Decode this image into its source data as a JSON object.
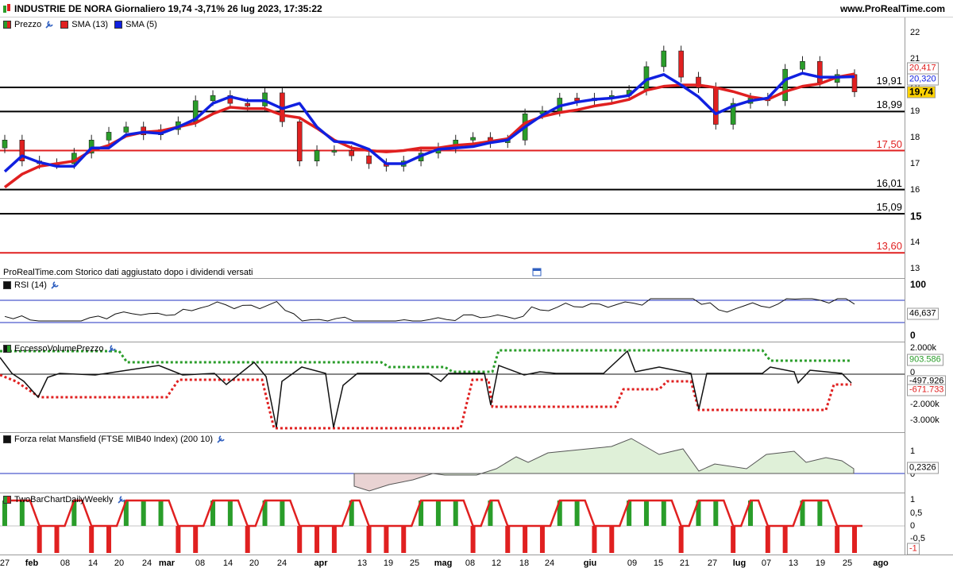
{
  "header": {
    "title": "INDUSTRIE DE NORA Giornaliero 19,74 -3,71% 26 lug 2023, 17:35:22",
    "brand": "www.ProRealTime.com"
  },
  "price_panel": {
    "legend": [
      {
        "label": "Prezzo",
        "color": "#2a9d2a"
      },
      {
        "label": "SMA (13)",
        "color": "#e02020"
      },
      {
        "label": "SMA (5)",
        "color": "#1020e0"
      }
    ],
    "note": "ProRealTime.com  Storico dati aggiustato dopo i dividendi versati",
    "y_ticks": [
      "22",
      "21",
      "20",
      "19",
      "18",
      "17",
      "16",
      "15",
      "14",
      "13"
    ],
    "levels": [
      {
        "label": "19,91",
        "value": 19.91,
        "color": "#000000"
      },
      {
        "label": "18,99",
        "value": 18.99,
        "color": "#000000"
      },
      {
        "label": "17,50",
        "value": 17.5,
        "color": "#e02020"
      },
      {
        "label": "16,01",
        "value": 16.01,
        "color": "#000000"
      },
      {
        "label": "15,09",
        "value": 15.09,
        "color": "#000000"
      },
      {
        "label": "13,60",
        "value": 13.6,
        "color": "#e02020"
      }
    ],
    "badges": {
      "sma13": "20,417",
      "sma5": "20,320",
      "price": "19,74"
    }
  },
  "rsi_panel": {
    "legend": "RSI (14)",
    "top": "100",
    "bottom": "0",
    "value": "46,637"
  },
  "evp_panel": {
    "legend": "EccessoVolumePrezzo",
    "ticks": [
      "2.000k",
      "0",
      "-2.000k",
      "-3.000k"
    ],
    "green_value": "903.586",
    "black_value": "-497.926",
    "red_value": "-671.733"
  },
  "mansfield_panel": {
    "legend": "Forza relat Mansfield (FTSE MIB40 Index) (200 10)",
    "tick_top": "1",
    "tick_zero": "0",
    "value": "0,2326"
  },
  "twobar_panel": {
    "legend": "TwoBarChartDailyWeekly",
    "ticks": [
      "1",
      "0,5",
      "0",
      "-0,5"
    ],
    "value": "-1"
  },
  "x_axis": [
    {
      "label": "27",
      "bold": false
    },
    {
      "label": "feb",
      "bold": true
    },
    {
      "label": "08",
      "bold": false
    },
    {
      "label": "14",
      "bold": false
    },
    {
      "label": "20",
      "bold": false
    },
    {
      "label": "24",
      "bold": false
    },
    {
      "label": "mar",
      "bold": true
    },
    {
      "label": "08",
      "bold": false
    },
    {
      "label": "14",
      "bold": false
    },
    {
      "label": "20",
      "bold": false
    },
    {
      "label": "24",
      "bold": false
    },
    {
      "label": "apr",
      "bold": true
    },
    {
      "label": "13",
      "bold": false
    },
    {
      "label": "19",
      "bold": false
    },
    {
      "label": "25",
      "bold": false
    },
    {
      "label": "mag",
      "bold": true
    },
    {
      "label": "08",
      "bold": false
    },
    {
      "label": "12",
      "bold": false
    },
    {
      "label": "18",
      "bold": false
    },
    {
      "label": "24",
      "bold": false
    },
    {
      "label": "giu",
      "bold": true
    },
    {
      "label": "09",
      "bold": false
    },
    {
      "label": "15",
      "bold": false
    },
    {
      "label": "21",
      "bold": false
    },
    {
      "label": "27",
      "bold": false
    },
    {
      "label": "lug",
      "bold": true
    },
    {
      "label": "07",
      "bold": false
    },
    {
      "label": "13",
      "bold": false
    },
    {
      "label": "19",
      "bold": false
    },
    {
      "label": "25",
      "bold": false
    },
    {
      "label": "ago",
      "bold": true
    }
  ],
  "chart_data": {
    "type": "candlestick",
    "series": [
      {
        "name": "SMA (5)",
        "values": [
          16.7,
          17.3,
          17.05,
          16.9,
          16.9,
          17.6,
          17.6,
          18.1,
          18.2,
          18.15,
          18.4,
          18.7,
          19.3,
          19.55,
          19.4,
          19.4,
          19.1,
          19.3,
          18.4,
          17.85,
          17.8,
          17.55,
          17.0,
          17.0,
          17.3,
          17.55,
          17.6,
          17.65,
          17.8,
          17.9,
          18.4,
          18.85,
          19.2,
          19.35,
          19.45,
          19.5,
          19.6,
          20.2,
          20.4,
          20.0,
          19.55,
          18.9,
          19.2,
          19.4,
          19.5,
          20.2,
          20.45,
          20.3,
          20.3,
          20.32
        ]
      },
      {
        "name": "SMA (13)",
        "values": [
          16.1,
          16.6,
          16.9,
          17.0,
          17.1,
          17.5,
          17.7,
          18.05,
          18.2,
          18.25,
          18.4,
          18.55,
          18.9,
          19.15,
          19.1,
          19.1,
          18.85,
          18.75,
          18.35,
          17.9,
          17.6,
          17.5,
          17.45,
          17.5,
          17.6,
          17.6,
          17.7,
          17.75,
          17.85,
          17.95,
          18.55,
          18.8,
          18.95,
          19.05,
          19.2,
          19.3,
          19.45,
          19.8,
          19.95,
          20.0,
          20.0,
          19.9,
          19.75,
          19.55,
          19.45,
          19.75,
          19.95,
          20.05,
          20.3,
          20.42
        ]
      },
      {
        "name": "Prezzo",
        "values": [
          17.9,
          17.1,
          17.0,
          17.0,
          17.4,
          17.9,
          18.2,
          18.4,
          18.1,
          18.3,
          18.6,
          19.4,
          19.6,
          19.3,
          19.2,
          19.7,
          18.6,
          17.1,
          17.5,
          17.5,
          17.3,
          17.0,
          16.9,
          17.1,
          17.4,
          17.6,
          17.9,
          18.0,
          17.8,
          17.9,
          18.9,
          19.0,
          19.5,
          19.4,
          19.5,
          19.6,
          19.8,
          20.7,
          21.3,
          20.3,
          19.9,
          18.5,
          19.3,
          19.5,
          19.4,
          20.6,
          20.9,
          20.1,
          20.4,
          19.74
        ]
      }
    ]
  }
}
